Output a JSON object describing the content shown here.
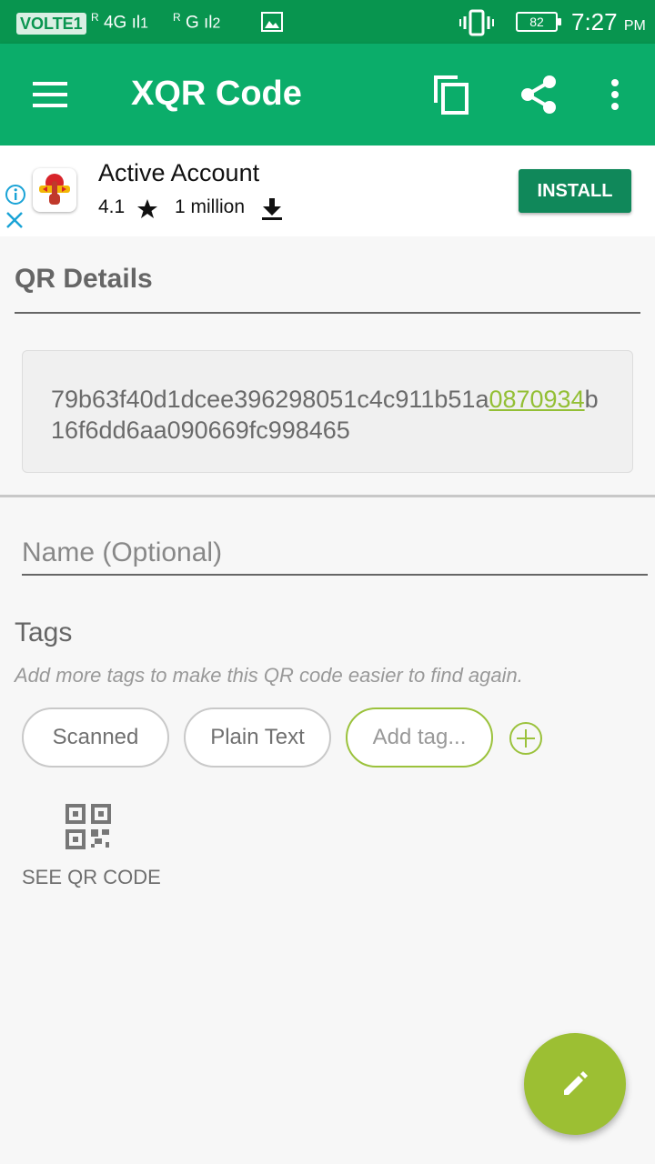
{
  "status_bar": {
    "volte": "VOLTE1",
    "sim1": "4G",
    "sim2": "G",
    "roaming": "R",
    "battery": "82",
    "time": "7:27",
    "ampm": "PM"
  },
  "toolbar": {
    "title": "XQR Code",
    "menu_icon": "hamburger-icon",
    "copy_icon": "copy-icon",
    "share_icon": "share-icon",
    "more_icon": "more-vert-icon"
  },
  "ad": {
    "app_name": "Active Account",
    "rating": "4.1",
    "downloads": "1 million",
    "install_label": "INSTALL"
  },
  "details": {
    "title": "QR Details",
    "content_prefix": "79b63f40d1dcee396298051c4c911b51a",
    "content_highlight": "0870934",
    "content_suffix": "b16f6dd6aa090669fc998465",
    "name_placeholder": "Name (Optional)"
  },
  "tags": {
    "title": "Tags",
    "hint": "Add more tags to make this QR code easier to find again.",
    "items": [
      "Scanned",
      "Plain Text"
    ],
    "add_placeholder": "Add tag..."
  },
  "see_qr": {
    "label": "SEE QR CODE"
  },
  "colors": {
    "status_bar": "#08954f",
    "app_bar": "#0bad6a",
    "accent": "#9cbf33",
    "install": "#10885a"
  }
}
